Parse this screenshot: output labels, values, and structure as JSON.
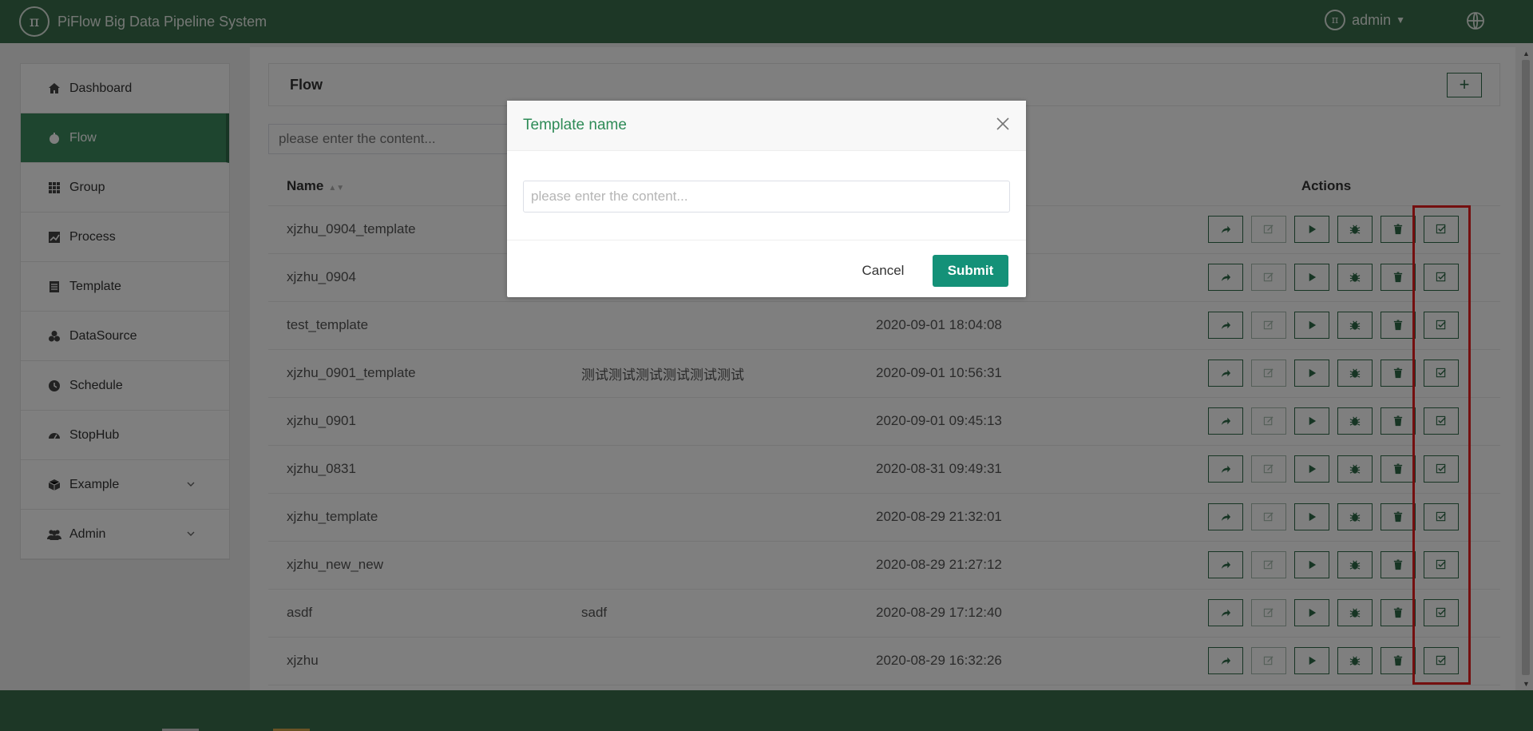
{
  "header": {
    "app_title": "PiFlow Big Data Pipeline System",
    "logo_glyph": "π",
    "user_name": "admin",
    "user_glyph": "π"
  },
  "sidebar": {
    "items": [
      {
        "label": "Dashboard",
        "icon": "home-icon",
        "active": false
      },
      {
        "label": "Flow",
        "icon": "flow-icon",
        "active": true
      },
      {
        "label": "Group",
        "icon": "grid-icon",
        "active": false
      },
      {
        "label": "Process",
        "icon": "chart-icon",
        "active": false
      },
      {
        "label": "Template",
        "icon": "template-icon",
        "active": false
      },
      {
        "label": "DataSource",
        "icon": "datasource-icon",
        "active": false
      },
      {
        "label": "Schedule",
        "icon": "clock-icon",
        "active": false
      },
      {
        "label": "StopHub",
        "icon": "gauge-icon",
        "active": false
      },
      {
        "label": "Example",
        "icon": "cube-icon",
        "active": false,
        "expandable": true
      },
      {
        "label": "Admin",
        "icon": "users-icon",
        "active": false,
        "expandable": true
      }
    ]
  },
  "main": {
    "title": "Flow",
    "add_label": "+",
    "search_placeholder": "please enter the content...",
    "columns": {
      "name": "Name",
      "actions": "Actions"
    },
    "rows": [
      {
        "name": "xjzhu_0904_template",
        "desc": "",
        "time": ""
      },
      {
        "name": "xjzhu_0904",
        "desc": "",
        "time": ""
      },
      {
        "name": "test_template",
        "desc": "",
        "time": "2020-09-01 18:04:08"
      },
      {
        "name": "xjzhu_0901_template",
        "desc": "测试测试测试测试测试测试",
        "time": "2020-09-01 10:56:31"
      },
      {
        "name": "xjzhu_0901",
        "desc": "",
        "time": "2020-09-01 09:45:13"
      },
      {
        "name": "xjzhu_0831",
        "desc": "",
        "time": "2020-08-31 09:49:31"
      },
      {
        "name": "xjzhu_template",
        "desc": "",
        "time": "2020-08-29 21:32:01"
      },
      {
        "name": "xjzhu_new_new",
        "desc": "",
        "time": "2020-08-29 21:27:12"
      },
      {
        "name": "asdf",
        "desc": "sadf",
        "time": "2020-08-29 17:12:40"
      },
      {
        "name": "xjzhu",
        "desc": "",
        "time": "2020-08-29 16:32:26"
      }
    ],
    "action_icons": [
      "share-icon",
      "edit-icon",
      "run-icon",
      "debug-icon",
      "delete-icon",
      "save-template-icon"
    ]
  },
  "dialog": {
    "title": "Template name",
    "input_placeholder": "please enter the content...",
    "input_value": "",
    "cancel_label": "Cancel",
    "submit_label": "Submit"
  },
  "colors": {
    "header_bg": "#3b6e4c",
    "active_nav": "#3d8a5f",
    "submit": "#149178",
    "highlight": "#e81e1e"
  }
}
